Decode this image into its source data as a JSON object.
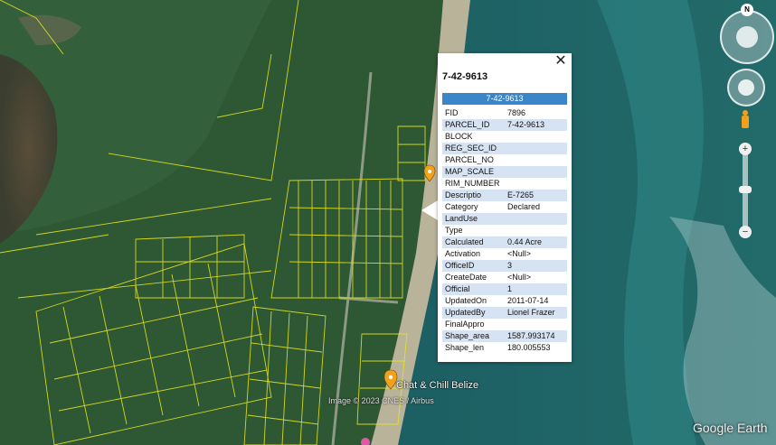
{
  "popup": {
    "title": "7-42-9613",
    "header_value": "7-42-9613",
    "close_label": "✕",
    "fields": [
      {
        "key": "FID",
        "value": "7896"
      },
      {
        "key": "PARCEL_ID",
        "value": "7-42-9613"
      },
      {
        "key": "BLOCK",
        "value": ""
      },
      {
        "key": "REG_SEC_ID",
        "value": ""
      },
      {
        "key": "PARCEL_NO",
        "value": ""
      },
      {
        "key": "MAP_SCALE",
        "value": ""
      },
      {
        "key": "RIM_NUMBER",
        "value": ""
      },
      {
        "key": "Descriptio",
        "value": "E-7265"
      },
      {
        "key": "Category",
        "value": "Declared"
      },
      {
        "key": "LandUse",
        "value": ""
      },
      {
        "key": "Type",
        "value": ""
      },
      {
        "key": "Calculated",
        "value": "0.44 Acre"
      },
      {
        "key": "Activation",
        "value": "<Null>"
      },
      {
        "key": "OfficeID",
        "value": "3"
      },
      {
        "key": "CreateDate",
        "value": "<Null>"
      },
      {
        "key": "Official",
        "value": "1"
      },
      {
        "key": "UpdatedOn",
        "value": "2011-07-14"
      },
      {
        "key": "UpdatedBy",
        "value": "Lionel Frazer"
      },
      {
        "key": "FinalAppro",
        "value": ""
      },
      {
        "key": "Shape_area",
        "value": "1587.993174"
      },
      {
        "key": "Shape_len",
        "value": "180.005553"
      }
    ]
  },
  "map": {
    "poi_label": "Chat & Chill Belize",
    "credit": "Image © 2023 CNES / Airbus",
    "brand": "Google Earth",
    "compass_letter": "N",
    "zoom_in": "+",
    "zoom_out": "−",
    "colors": {
      "parcel_line": "#e8e81a",
      "land": "#2f5a34",
      "sea": "#1f6a6a",
      "reef": "#3e9a9a",
      "marker": "#f2a11c"
    }
  }
}
